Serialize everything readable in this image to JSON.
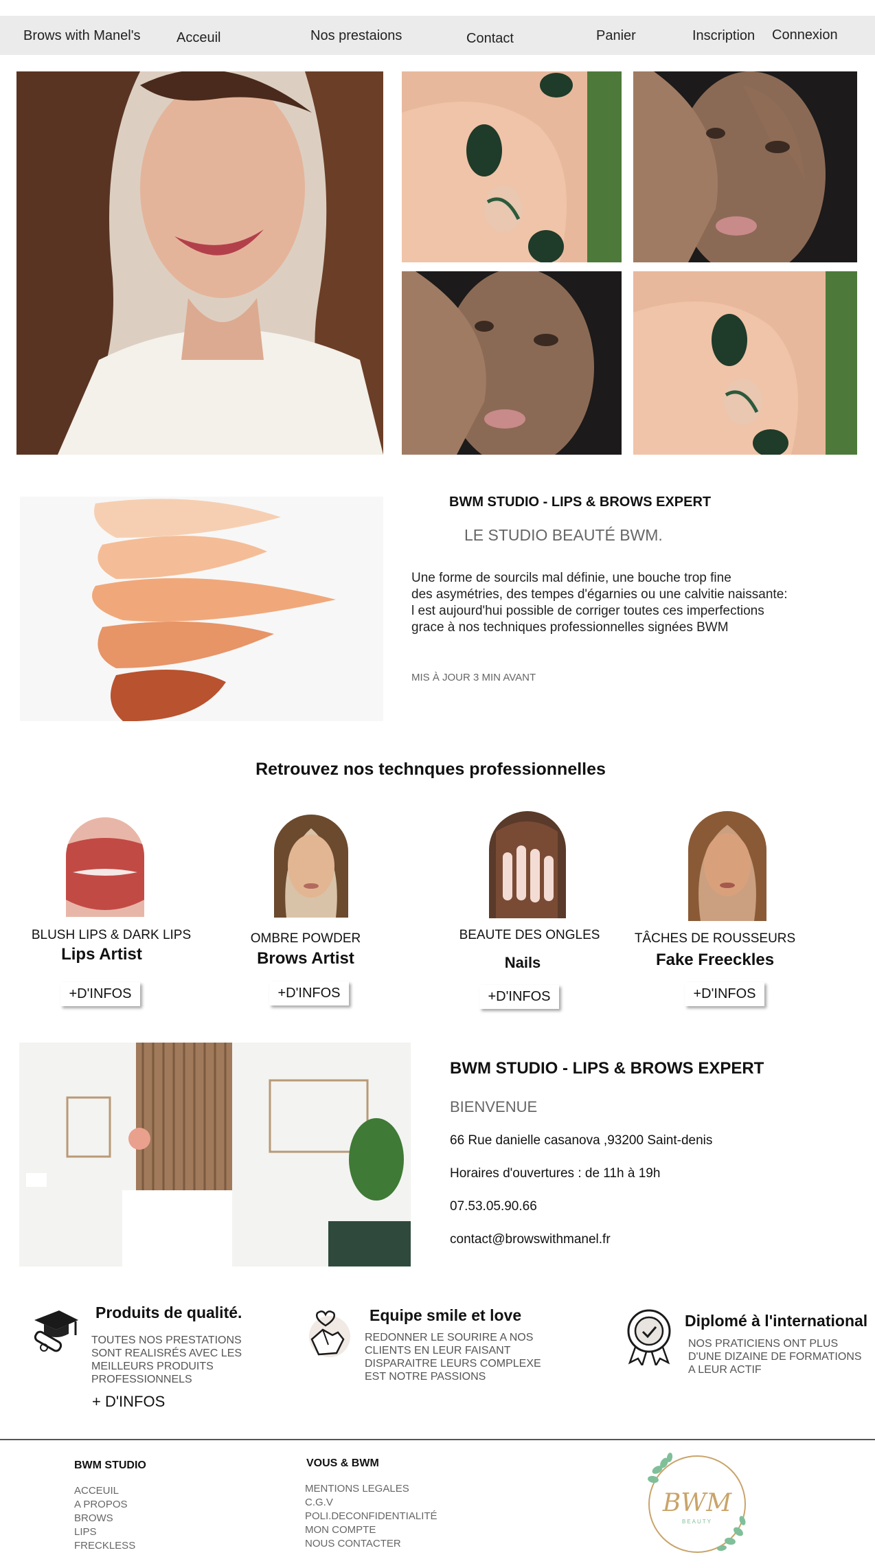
{
  "nav": {
    "brand": "Brows with Manel's",
    "items": [
      "Acceuil",
      "Nos prestaions",
      "Contact",
      "Panier",
      "Inscription",
      "Connexion"
    ]
  },
  "about": {
    "heading": "BWM STUDIO - LIPS & BROWS EXPERT",
    "subheading": "LE STUDIO BEAUTÉ BWM.",
    "paragraph_lines": [
      "Une forme de sourcils mal définie, une bouche trop fine",
      "des asymétries, des tempes d'égarnies ou une calvitie naissante:",
      "l est aujourd'hui possible de corriger toutes ces imperfections",
      "grace à nos techniques professionnelles signées BWM"
    ],
    "updated": "MIS À JOUR 3 MIN AVANT"
  },
  "services": {
    "title": "Retrouvez nos technques professionnelles",
    "items": [
      {
        "category": "BLUSH LIPS & DARK LIPS",
        "name": "Lips Artist",
        "button": "+D'INFOS"
      },
      {
        "category": "OMBRE POWDER",
        "name": "Brows Artist",
        "button": "+D'INFOS"
      },
      {
        "category": "BEAUTE DES ONGLES",
        "name": "Nails",
        "button": "+D'INFOS"
      },
      {
        "category": "TÂCHES DE ROUSSEURS",
        "name": "Fake Freeckles",
        "button": "+D'INFOS"
      }
    ]
  },
  "contact": {
    "heading": "BWM STUDIO - LIPS & BROWS EXPERT",
    "welcome": "BIENVENUE",
    "address": "66 Rue danielle casanova ,93200 Saint-denis",
    "hours": "Horaires d'ouvertures : de 11h à 19h",
    "phone": "07.53.05.90.66",
    "email": "contact@browswithmanel.fr"
  },
  "features": [
    {
      "title": "Produits de qualité.",
      "icon": "graduation-cap-icon",
      "lines": [
        "TOUTES NOS PRESTATIONS",
        "SONT REALISRÉS AVEC LES",
        "MEILLEURS PRODUITS",
        "PROFESSIONNELS"
      ],
      "button": "+ D'INFOS"
    },
    {
      "title": "Equipe smile et love",
      "icon": "heart-hand-icon",
      "lines": [
        "REDONNER LE SOURIRE A NOS",
        "CLIENTS EN LEUR FAISANT",
        "DISPARAITRE LEURS COMPLEXE",
        "EST NOTRE PASSIONS"
      ]
    },
    {
      "title": "Diplomé à l'international",
      "icon": "award-badge-icon",
      "lines": [
        "NOS PRATICIENS ONT PLUS",
        "D'UNE DIZAINE DE FORMATIONS",
        "A LEUR ACTIF"
      ]
    }
  ],
  "footer": {
    "col1": {
      "title": "BWM STUDIO",
      "links": [
        "ACCEUIL",
        "A PROPOS",
        "BROWS",
        "LIPS",
        "FRECKLESS"
      ]
    },
    "col2": {
      "title": "VOUS & BWM",
      "links": [
        "MENTIONS LEGALES",
        "C.G.V",
        "POLI.DECONFIDENTIALITÉ",
        "MON COMPTE",
        "NOUS CONTACTER"
      ]
    },
    "logo": {
      "text": "BWM",
      "subtext": "BEAUTY"
    }
  },
  "colors": {
    "nav_bg": "#ebebeb",
    "gold": "#c9a46a",
    "leaf": "#7fbf9a"
  }
}
